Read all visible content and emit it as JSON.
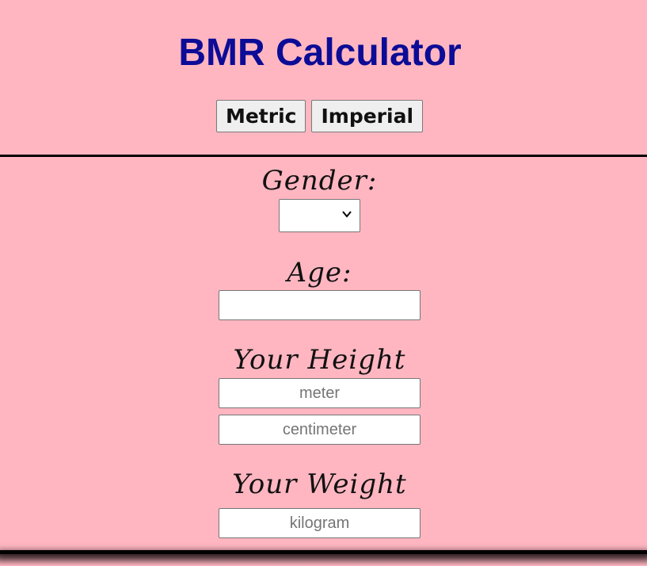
{
  "header": {
    "title": "BMR Calculator",
    "metric_label": "Metric",
    "imperial_label": "Imperial"
  },
  "form": {
    "gender": {
      "label": "Gender:",
      "selected": ""
    },
    "age": {
      "label": "Age:",
      "value": "",
      "placeholder": ""
    },
    "height": {
      "label": "Your Height",
      "meter_placeholder": "meter",
      "centimeter_placeholder": "centimeter"
    },
    "weight": {
      "label": "Your Weight",
      "kilogram_placeholder": "kilogram"
    }
  },
  "icons": {
    "gender_select_arrow": "chevron-down-icon"
  },
  "colors": {
    "background": "#ffb6c1",
    "title": "#0c0c96",
    "divider": "#000000"
  }
}
